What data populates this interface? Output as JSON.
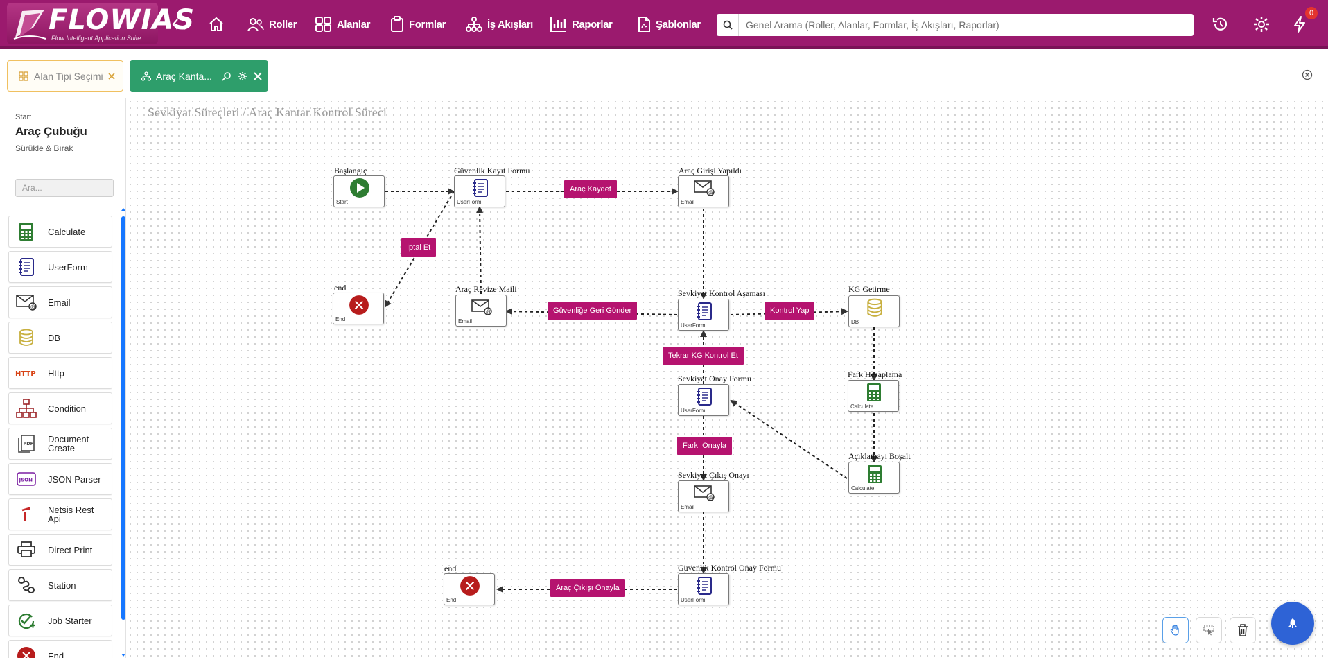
{
  "app": {
    "logo_text": "FLOWIAS",
    "logo_subtitle": "Flow Intelligent Application Suite"
  },
  "nav": {
    "items": [
      {
        "label": "Roller",
        "icon": "users-icon"
      },
      {
        "label": "Alanlar",
        "icon": "grid-icon"
      },
      {
        "label": "Formlar",
        "icon": "clipboard-icon"
      },
      {
        "label": "İş Akışları",
        "icon": "workflow-icon"
      },
      {
        "label": "Raporlar",
        "icon": "bar-chart-icon"
      },
      {
        "label": "Şablonlar",
        "icon": "file-pdf-icon"
      }
    ],
    "search_placeholder": "Genel Arama (Roller, Alanlar, Formlar, İş Akışları, Raporlar)",
    "notification_count": "0"
  },
  "tabs": [
    {
      "label": "Alan Tipi Seçimi",
      "active": false
    },
    {
      "label": "Araç Kanta...",
      "active": true
    }
  ],
  "sidebar": {
    "small": "Start",
    "title": "Araç Çubuğu",
    "subtitle": "Sürükle & Bırak",
    "search_placeholder": "Ara...",
    "tools": [
      {
        "label": "Calculate",
        "icon": "calculator-icon"
      },
      {
        "label": "UserForm",
        "icon": "form-icon"
      },
      {
        "label": "Email",
        "icon": "email-icon"
      },
      {
        "label": "DB",
        "icon": "database-icon"
      },
      {
        "label": "Http",
        "icon": "http-icon"
      },
      {
        "label": "Condition",
        "icon": "condition-icon"
      },
      {
        "label": "Document Create",
        "icon": "pdf-document-icon"
      },
      {
        "label": "JSON Parser",
        "icon": "json-icon"
      },
      {
        "label": "Netsis Rest Api",
        "icon": "netsis-icon"
      },
      {
        "label": "Direct Print",
        "icon": "printer-icon"
      },
      {
        "label": "Station",
        "icon": "station-icon"
      },
      {
        "label": "Job Starter",
        "icon": "job-starter-icon"
      },
      {
        "label": "End",
        "icon": "end-icon"
      }
    ]
  },
  "canvas": {
    "breadcrumb": "Sevkiyat Süreçleri / Araç Kantar Kontrol Süreci",
    "nodes": [
      {
        "id": "n1",
        "title": "Başlangıç",
        "type": "Start"
      },
      {
        "id": "n2",
        "title": "Güvenlik Kayıt Formu",
        "type": "UserForm"
      },
      {
        "id": "n3",
        "title": "Araç Girişi Yapıldı",
        "type": "Email"
      },
      {
        "id": "n4",
        "title": "end",
        "type": "End"
      },
      {
        "id": "n5",
        "title": "Araç Revize Maili",
        "type": "Email"
      },
      {
        "id": "n6",
        "title": "Sevkiyat Kontrol Aşaması",
        "type": "UserForm"
      },
      {
        "id": "n7",
        "title": "KG Getirme",
        "type": "DB"
      },
      {
        "id": "n8",
        "title": "Sevkiyat Onay Formu",
        "type": "UserForm"
      },
      {
        "id": "n9",
        "title": "Fark Hesaplama",
        "type": "Calculate"
      },
      {
        "id": "n10",
        "title": "Açıklamayı Boşalt",
        "type": "Calculate"
      },
      {
        "id": "n11",
        "title": "Sevkiyat Çıkış Onayı",
        "type": "Email"
      },
      {
        "id": "n12",
        "title": "end",
        "type": "End"
      },
      {
        "id": "n13",
        "title": "Guvenlik Kontrol Onay Formu",
        "type": "UserForm"
      }
    ],
    "edge_labels": [
      "Araç Kaydet",
      "İptal Et",
      "Güvenliğe Geri Gönder",
      "Kontrol Yap",
      "Tekrar KG Kontrol Et",
      "Farkı Onayla",
      "Araç Çıkışı Onayla"
    ]
  },
  "colors": {
    "brand": "#9b1a6e",
    "edge_label": "#b5136f",
    "tab_active": "#2e9e6b",
    "start": "#2e7d32",
    "end": "#b71c1c",
    "fab": "#2e63d6"
  }
}
